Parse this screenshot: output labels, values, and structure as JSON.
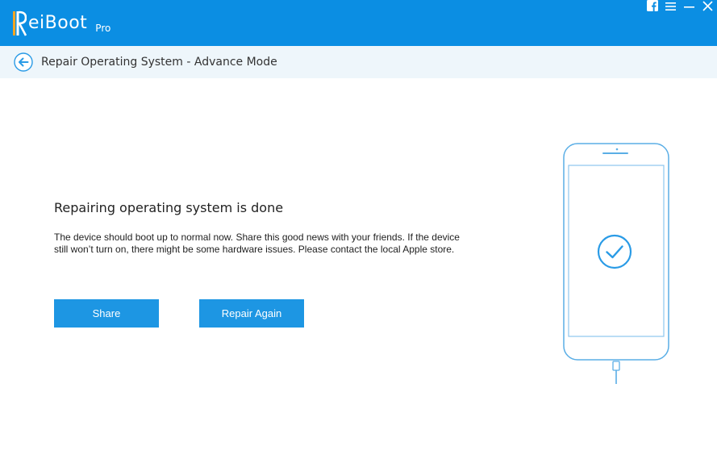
{
  "app": {
    "name": "eiBoot",
    "edition": "Pro",
    "brand_color": "#0b8ee3",
    "accent_color": "#1d96e3",
    "logo_accent": "#f5a623"
  },
  "window_controls": [
    {
      "icon": "facebook-icon"
    },
    {
      "icon": "menu-icon"
    },
    {
      "icon": "minimize-icon"
    },
    {
      "icon": "close-icon"
    }
  ],
  "header": {
    "back_icon": "back-arrow-icon",
    "title": "Repair Operating System - Advance Mode"
  },
  "main": {
    "title": "Repairing operating system is done",
    "description": "The device should boot up to normal now. Share this good news with your friends. If the device still won’t turn on, there might be some hardware issues. Please contact the local Apple store.",
    "share_label": "Share",
    "repair_again_label": "Repair Again"
  },
  "illustration": {
    "device_icon": "phone-icon",
    "status_icon": "checkmark-circle-icon"
  }
}
